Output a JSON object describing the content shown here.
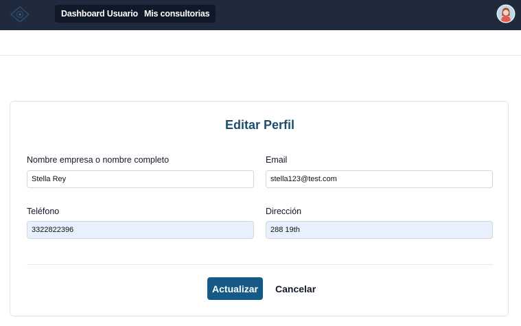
{
  "nav": {
    "logo_icon": "company-logo-icon",
    "items": [
      {
        "label": "Dashboard Usuario"
      },
      {
        "label": "Mis consultorias"
      }
    ],
    "avatar_icon": "user-avatar-icon"
  },
  "form": {
    "title": "Editar Perfil",
    "fields": {
      "name": {
        "label": "Nombre empresa o nombre completo",
        "value": "Stella Rey"
      },
      "email": {
        "label": "Email",
        "value": "stella123@test.com"
      },
      "phone": {
        "label": "Teléfono",
        "value": "3322822396"
      },
      "address": {
        "label": "Dirección",
        "value": "288 19th"
      }
    },
    "submit_label": "Actualizar",
    "cancel_label": "Cancelar"
  },
  "colors": {
    "navbar_bg": "#1f2a3c",
    "accent": "#155a86",
    "title": "#1b4d6e",
    "autofill_bg": "#e8f0fe"
  }
}
